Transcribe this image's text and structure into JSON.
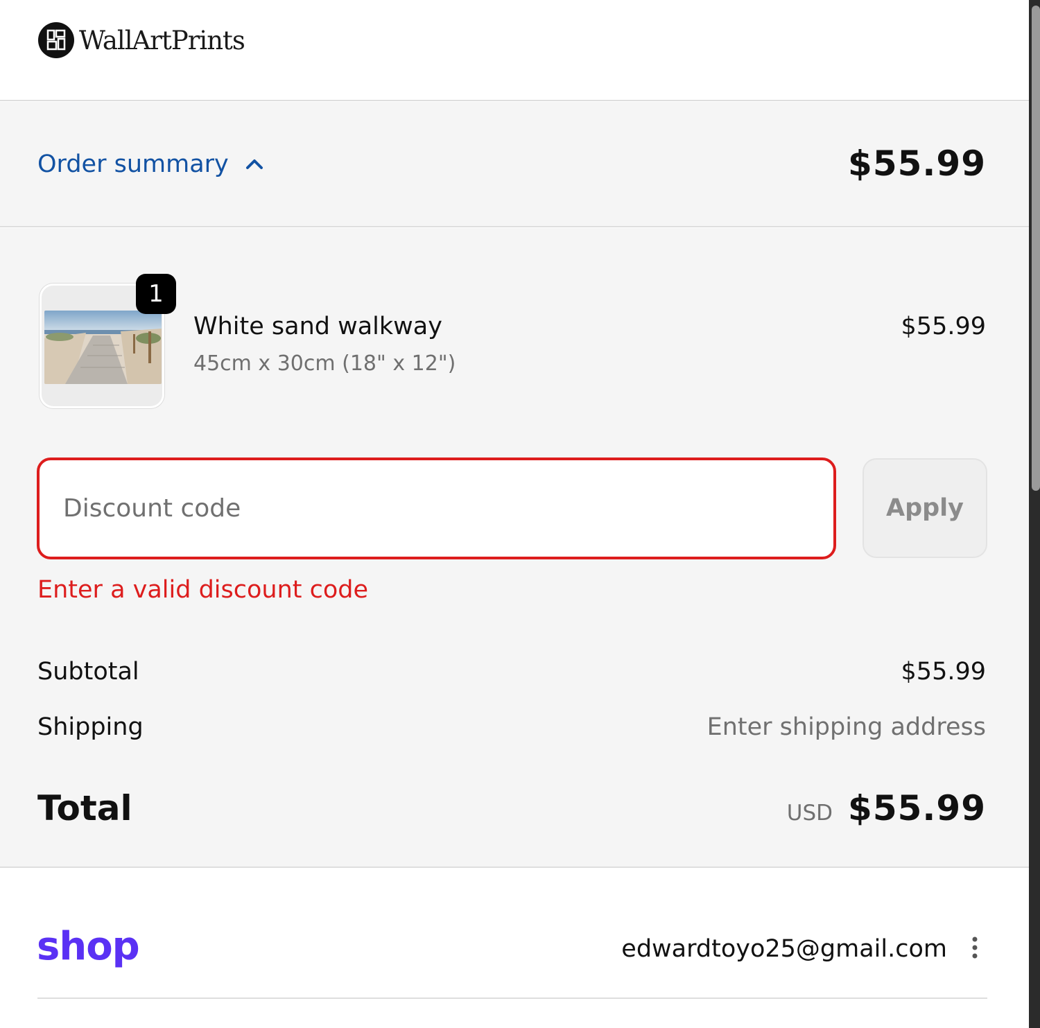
{
  "header": {
    "brand_name": "WallArtPrints",
    "logo_icon": "wallartprints-logo-icon"
  },
  "summary": {
    "toggle_label": "Order summary",
    "toggle_icon": "chevron-up-icon",
    "header_total": "$55.99"
  },
  "line_items": [
    {
      "quantity": "1",
      "title": "White sand walkway",
      "variant": "45cm x 30cm (18\" x 12\")",
      "price": "$55.99",
      "image": "beach-walkway-thumbnail"
    }
  ],
  "discount": {
    "placeholder": "Discount code",
    "value": "",
    "apply_label": "Apply",
    "error": "Enter a valid discount code"
  },
  "totals": {
    "subtotal_label": "Subtotal",
    "subtotal_value": "$55.99",
    "shipping_label": "Shipping",
    "shipping_value": "Enter shipping address",
    "total_label": "Total",
    "currency": "USD",
    "total_value": "$55.99"
  },
  "shop_pay": {
    "logo_text": "shop",
    "email": "edwardtoyo25@gmail.com",
    "menu_icon": "more-vertical-icon"
  },
  "colors": {
    "link_blue": "#1252a3",
    "error_red": "#dd1d1d",
    "shop_purple": "#5a31f4",
    "panel_bg": "#f5f5f5"
  }
}
